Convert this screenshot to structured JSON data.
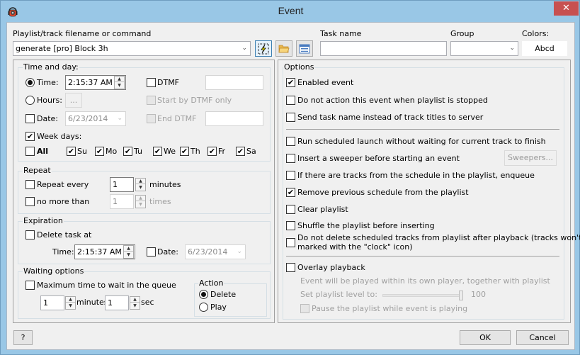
{
  "window": {
    "title": "Event",
    "close_label": "✕"
  },
  "top": {
    "playlist_label": "Playlist/track filename or command",
    "playlist_value": "generate [pro] Block 3h",
    "task_name_label": "Task name",
    "task_name_value": "",
    "group_label": "Group",
    "group_value": "",
    "colors_label": "Colors:",
    "colors_button": "Abcd",
    "dropdown_arrow": "⌄"
  },
  "time_and_day": {
    "title": "Time and day:",
    "time_label": "Time:",
    "time_value": "2:15:37 AM",
    "time_selected": true,
    "hours_label": "Hours:",
    "hours_button": "...",
    "date_label": "Date:",
    "date_value": "6/23/2014",
    "date_checked": false,
    "dtmf_label": "DTMF",
    "dtmf_value": "",
    "start_by_dtmf_label": "Start by DTMF only",
    "end_dtmf_label": "End DTMF",
    "end_dtmf_value": "",
    "week_days_label": "Week days:",
    "week_days_checked": true,
    "all_label": "All",
    "all_checked": false,
    "days": [
      {
        "label": "Su",
        "checked": true
      },
      {
        "label": "Mo",
        "checked": true
      },
      {
        "label": "Tu",
        "checked": true
      },
      {
        "label": "We",
        "checked": true
      },
      {
        "label": "Th",
        "checked": true
      },
      {
        "label": "Fr",
        "checked": true
      },
      {
        "label": "Sa",
        "checked": true
      }
    ]
  },
  "repeat": {
    "title": "Repeat",
    "repeat_every_label": "Repeat every",
    "repeat_every_value": "1",
    "minutes_label": "minutes",
    "no_more_than_label": "no more than",
    "no_more_than_value": "1",
    "times_label": "times"
  },
  "expiration": {
    "title": "Expiration",
    "delete_task_label": "Delete task at",
    "time_label": "Time:",
    "time_value": "2:15:37 AM",
    "date_label": "Date:",
    "date_value": "6/23/2014"
  },
  "waiting": {
    "title": "Waiting options",
    "max_time_label": "Maximum time to wait in the queue",
    "minutes_value": "1",
    "minutes_label": "minutes",
    "sec_value": "1",
    "sec_label": "sec",
    "action_title": "Action",
    "action_delete": "Delete",
    "action_play": "Play",
    "action_selected": "Delete"
  },
  "options": {
    "title": "Options",
    "enabled_event": "Enabled event",
    "do_not_action": "Do not action this event when playlist is stopped",
    "send_task_name": "Send task name instead of track titles to server",
    "run_scheduled": "Run scheduled launch without waiting for current track to finish",
    "insert_sweeper": "Insert a sweeper before starting an event",
    "sweepers_button": "Sweepers...",
    "if_tracks_enqueue": "If there are tracks from the schedule in the playlist, enqueue",
    "remove_previous": "Remove previous schedule from the playlist",
    "clear_playlist": "Clear playlist",
    "shuffle": "Shuffle the playlist before inserting",
    "do_not_delete_line1": "Do not delete scheduled tracks from playlist after playback (tracks won't be",
    "do_not_delete_line2": "marked with the \"clock\" icon)",
    "overlay_playback": "Overlay playback",
    "overlay_desc": "Event will be played within its own player, together with playlist",
    "set_level_label": "Set playlist level to:",
    "level_value": "100",
    "level_fraction": 1.0,
    "pause_playlist": "Pause the playlist while event is playing"
  },
  "footer": {
    "help_button": "?",
    "ok_button": "OK",
    "cancel_button": "Cancel"
  },
  "check_mark": "✔"
}
